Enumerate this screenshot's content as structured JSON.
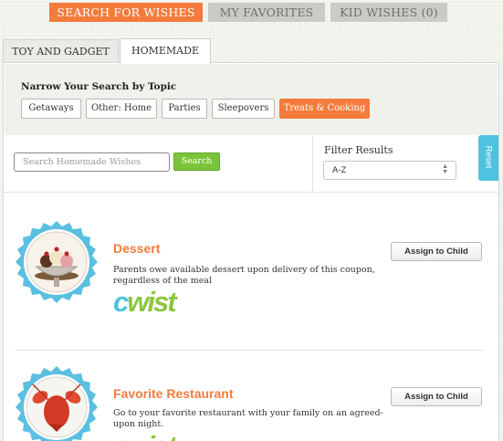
{
  "top_tabs": [
    {
      "label": "SEARCH FOR WISHES",
      "active": true
    },
    {
      "label": "MY FAVORITES",
      "active": false
    },
    {
      "label": "KID WISHES (0)",
      "active": false
    }
  ],
  "category_tabs": [
    {
      "label": "TOY AND GADGET",
      "active": false
    },
    {
      "label": "HOMEMADE",
      "active": true
    }
  ],
  "narrow": {
    "title": "Narrow Your Search by Topic",
    "topics": [
      {
        "label": "Getaways",
        "active": false
      },
      {
        "label": "Other: Home",
        "active": false
      },
      {
        "label": "Parties",
        "active": false
      },
      {
        "label": "Sleepovers",
        "active": false
      },
      {
        "label": "Treats & Cooking",
        "active": true
      }
    ]
  },
  "search": {
    "placeholder": "Search Homemade Wishes",
    "button_label": "Search"
  },
  "filter": {
    "label": "Filter Results",
    "selected": "A-Z"
  },
  "reset_label": "Reset",
  "wishes": [
    {
      "title": "Dessert",
      "description": "Parents owe available dessert upon delivery of this coupon, regardless of the meal",
      "logo_text": "cwist",
      "button_label": "Assign to Child",
      "icon": "sundae-icon"
    },
    {
      "title": "Favorite Restaurant",
      "description": "Go to your favorite restaurant with your family on an agreed-upon night.",
      "logo_text": "cwist",
      "button_label": "Assign to Child",
      "icon": "lobster-icon"
    }
  ],
  "colors": {
    "accent": "#f47b3c",
    "search_green": "#79c43a",
    "reset_blue": "#4ec3df",
    "badge_blue": "#5bbfe0",
    "logo_green": "#8cc63f"
  }
}
